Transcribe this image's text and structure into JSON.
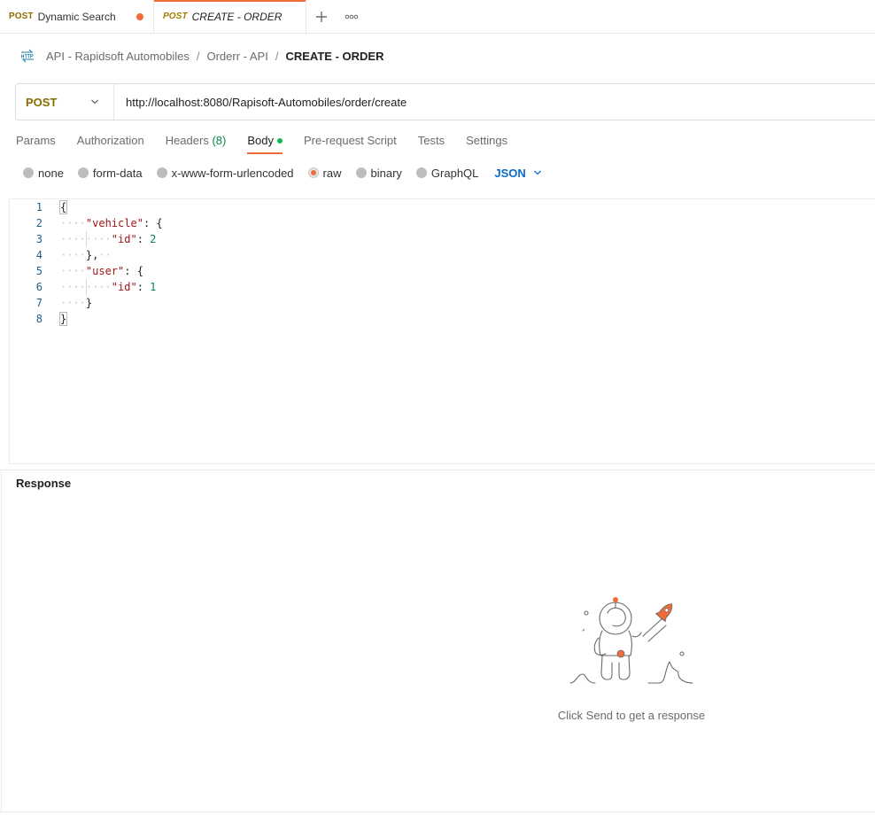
{
  "tabs": [
    {
      "method": "POST",
      "name": "Dynamic Search",
      "unsaved": true
    },
    {
      "method": "POST",
      "name": "CREATE - ORDER",
      "active": true
    }
  ],
  "breadcrumb": {
    "items": [
      "API - Rapidsoft Automobiles",
      "Orderr - API"
    ],
    "current": "CREATE - ORDER",
    "separator": "/"
  },
  "request": {
    "method": "POST",
    "url": "http://localhost:8080/Rapisoft-Automobiles/order/create"
  },
  "request_tabs": {
    "params": "Params",
    "authorization": "Authorization",
    "headers": "Headers",
    "headers_count": "(8)",
    "body": "Body",
    "prerequest": "Pre-request Script",
    "tests": "Tests",
    "settings": "Settings"
  },
  "body_types": {
    "none": "none",
    "form_data": "form-data",
    "urlencoded": "x-www-form-urlencoded",
    "raw": "raw",
    "binary": "binary",
    "graphql": "GraphQL",
    "format": "JSON",
    "selected": "raw"
  },
  "editor": {
    "line_numbers": [
      "1",
      "2",
      "3",
      "4",
      "5",
      "6",
      "7",
      "8"
    ],
    "code": {
      "l1": "{",
      "l2_key": "\"vehicle\"",
      "l2_rest": ": {",
      "l3_key": "\"id\"",
      "l3_colon": ": ",
      "l3_val": "2",
      "l4": "},",
      "l5_key": "\"user\"",
      "l5_rest": ": {",
      "l6_key": "\"id\"",
      "l6_colon": ": ",
      "l6_val": "1",
      "l7": "}",
      "l8": "}"
    }
  },
  "response": {
    "title": "Response",
    "hint": "Click Send to get a response"
  },
  "colors": {
    "accent": "#f26b3a",
    "post_method": "#8a6d00",
    "json_link": "#0b6bcb",
    "green_dot": "#0cbb52"
  }
}
